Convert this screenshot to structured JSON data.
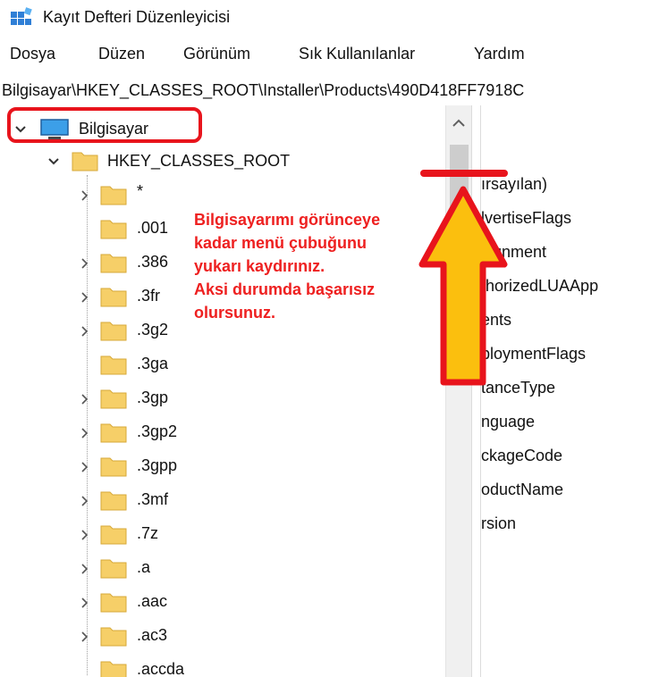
{
  "window": {
    "title": "Kayıt Defteri Düzenleyicisi"
  },
  "menu": [
    "Dosya",
    "Düzen",
    "Görünüm",
    "Sık Kullanılanlar",
    "Yardım"
  ],
  "address": "Bilgisayar\\HKEY_CLASSES_ROOT\\Installer\\Products\\490D418FF7918C",
  "tree": {
    "root": "Bilgisayar",
    "hive": "HKEY_CLASSES_ROOT",
    "keys": [
      "*",
      ".001",
      ".386",
      ".3fr",
      ".3g2",
      ".3ga",
      ".3gp",
      ".3gp2",
      ".3gpp",
      ".3mf",
      ".7z",
      ".a",
      ".aac",
      ".ac3",
      ".accda"
    ]
  },
  "values": [
    "ırsayılan)",
    "lvertiseFlags",
    "signment",
    "thorizedLUAApp",
    "ents",
    "ploymentFlags",
    "tanceType",
    "nguage",
    "ckageCode",
    "oductName",
    "rsion"
  ],
  "annotation": {
    "lines": [
      "Bilgisayarımı görünceye",
      "kadar menü çubuğunu",
      "yukarı kaydırınız.",
      "Aksi durumda başarısız",
      "olursunuz."
    ],
    "color": "#ee2020"
  },
  "colors": {
    "arrow_fill": "#fbbf0e",
    "annotation_red": "#e8141c",
    "folder": "#f6cf68"
  }
}
